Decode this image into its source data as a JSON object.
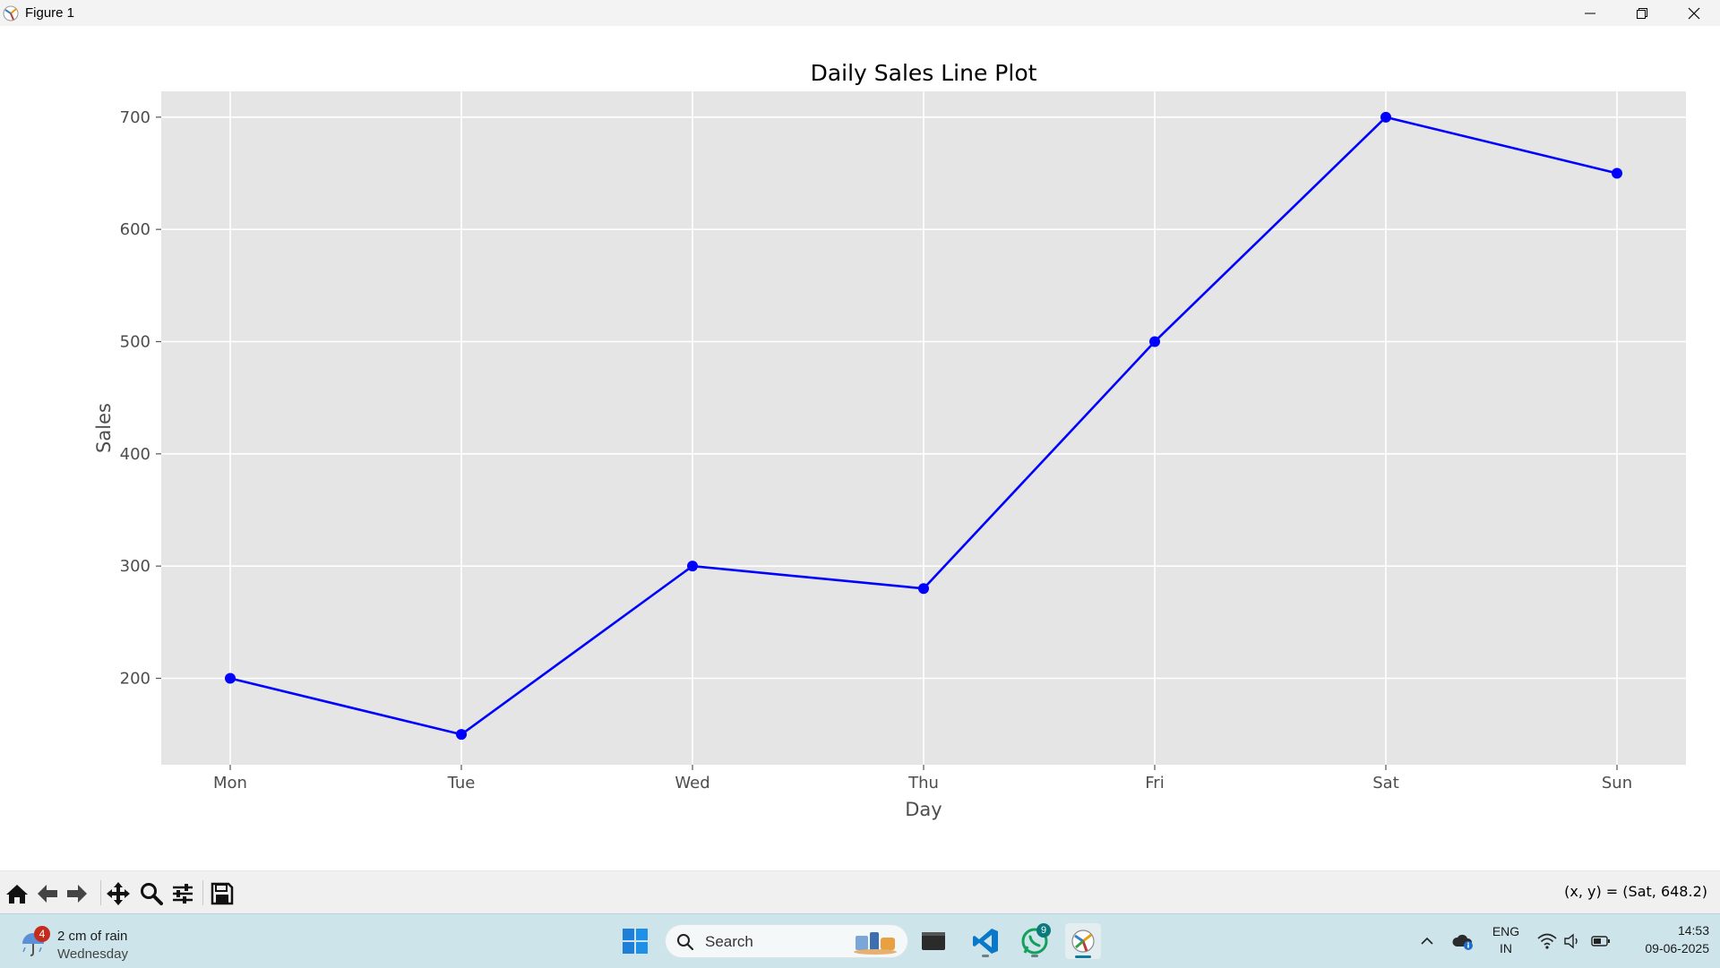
{
  "window": {
    "title": "Figure 1",
    "minimize_label": "minimize",
    "maximize_label": "restore",
    "close_label": "close"
  },
  "chart_data": {
    "type": "line",
    "title": "Daily Sales Line Plot",
    "xlabel": "Day",
    "ylabel": "Sales",
    "categories": [
      "Mon",
      "Tue",
      "Wed",
      "Thu",
      "Fri",
      "Sat",
      "Sun"
    ],
    "series": [
      {
        "values": [
          200,
          150,
          300,
          280,
          500,
          700,
          650
        ],
        "color": "#0000ff",
        "marker": "circle"
      }
    ],
    "y_ticks": [
      200,
      300,
      400,
      500,
      600,
      700
    ],
    "ylim": [
      123,
      723
    ],
    "grid": true,
    "style": "ggplot",
    "axes_background": "#e5e5e5",
    "grid_color": "#ffffff"
  },
  "toolbar": {
    "buttons": [
      "home-icon",
      "back-arrow-icon",
      "forward-arrow-icon",
      "pan-icon",
      "zoom-icon",
      "configure-subplots-icon",
      "save-icon"
    ],
    "coordinate_readout": "(x, y) = (Sat, 648.2)"
  },
  "taskbar": {
    "weather": {
      "badge": "4",
      "line1": "2 cm of rain",
      "line2": "Wednesday"
    },
    "search_placeholder": "Search",
    "whatsapp_badge": "9",
    "language": {
      "line1": "ENG",
      "line2": "IN"
    },
    "time": "14:53",
    "date": "09-06-2025"
  }
}
